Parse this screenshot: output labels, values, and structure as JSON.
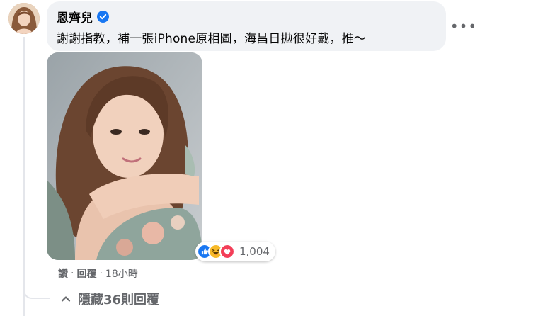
{
  "comment": {
    "author": "恩齊兒",
    "text": "謝謝指教，補一張iPhone原相圖，海昌日拋很好戴，推～",
    "more_label": "•••",
    "reaction_count": "1,004",
    "reactions": [
      "like-icon",
      "haha-icon",
      "love-icon"
    ],
    "actions": {
      "like": "讚",
      "reply": "回覆",
      "time": "18小時",
      "separator": "·"
    },
    "hide_replies": "隱藏36則回覆"
  },
  "colors": {
    "bubble_bg": "#f0f2f5",
    "secondary_text": "#65676b",
    "verified_blue": "#1877f2",
    "like_blue": "#1877f2",
    "haha_yellow": "#f7b928",
    "love_red": "#f33e58"
  }
}
